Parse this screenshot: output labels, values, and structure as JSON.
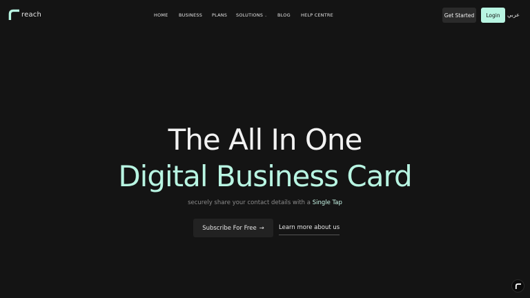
{
  "brand": {
    "name": "reach",
    "accent_color": "#b8f5e2"
  },
  "nav": {
    "items": [
      {
        "label": "HOME"
      },
      {
        "label": "BUSINESS"
      },
      {
        "label": "PLANS"
      },
      {
        "label": "SOLUTIONS",
        "has_dropdown": true
      },
      {
        "label": "BLOG"
      },
      {
        "label": "HELP CENTRE"
      }
    ]
  },
  "header": {
    "get_started_label": "Get Started",
    "login_label": "Login",
    "language_label": "عربي"
  },
  "hero": {
    "title_line1": "The All In One",
    "title_line2": "Digital Business Card",
    "subtitle_prefix": "securely share your contact details with a",
    "subtitle_highlight": "Single Tap",
    "subscribe_label": "Subscribe For Free",
    "subscribe_arrow": "→",
    "learn_more_label": "Learn more about us"
  },
  "icons": {
    "logo": "reach-logo-icon",
    "dropdown": "chevron-down-icon",
    "fab": "reach-logo-icon"
  }
}
